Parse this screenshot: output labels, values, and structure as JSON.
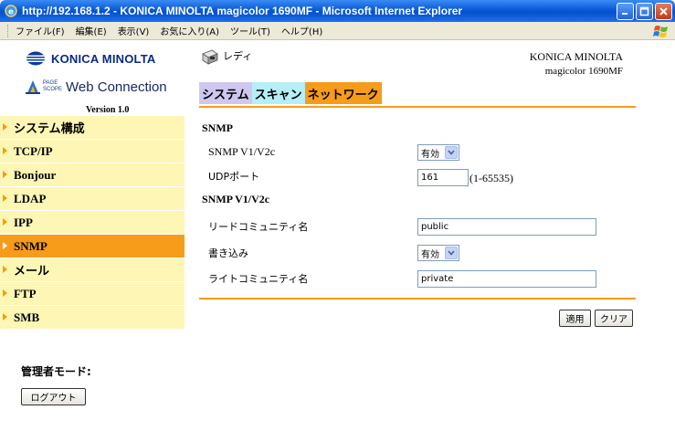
{
  "window": {
    "title": "http://192.168.1.2 - KONICA MINOLTA magicolor 1690MF - Microsoft Internet Explorer"
  },
  "menu": [
    "ファイル(F)",
    "編集(E)",
    "表示(V)",
    "お気に入り(A)",
    "ツール(T)",
    "ヘルプ(H)"
  ],
  "logos": {
    "konica": "KONICA MINOLTA",
    "pagescope_small_1": "PAGE",
    "pagescope_small_2": "SCOPE",
    "webconnection": "Web Connection",
    "version": "Version 1.0"
  },
  "sidebar": {
    "items": [
      {
        "label": "システム構成",
        "active": false
      },
      {
        "label": "TCP/IP",
        "active": false
      },
      {
        "label": "Bonjour",
        "active": false
      },
      {
        "label": "LDAP",
        "active": false
      },
      {
        "label": "IPP",
        "active": false
      },
      {
        "label": "SNMP",
        "active": true
      },
      {
        "label": "メール",
        "active": false
      },
      {
        "label": "FTP",
        "active": false
      },
      {
        "label": "SMB",
        "active": false
      }
    ],
    "admin_label": "管理者モード:",
    "logout_label": "ログアウト"
  },
  "header": {
    "status": "レディ",
    "brand": "KONICA MINOLTA",
    "model": "magicolor 1690MF"
  },
  "tabs": [
    {
      "label": "システム"
    },
    {
      "label": "スキャン"
    },
    {
      "label": "ネットワーク"
    }
  ],
  "form": {
    "section1_title": "SNMP",
    "snmp_v1v2c_label": "SNMP V1/V2c",
    "snmp_v1v2c_value": "有効",
    "udp_port_label": "UDPポート",
    "udp_port_value": "161",
    "udp_port_range": "(1-65535)",
    "section2_title": "SNMP V1/V2c",
    "read_community_label": "リードコミュニティ名",
    "read_community_value": "public",
    "write_label": "書き込み",
    "write_value": "有効",
    "write_community_label": "ライトコミュニティ名",
    "write_community_value": "private"
  },
  "buttons": {
    "apply": "適用",
    "clear": "クリア"
  },
  "colors": {
    "accent_orange": "#f79b1a",
    "nav_bg": "#fdf6b5",
    "tab_system": "#cfc7ef",
    "tab_scan": "#b5eef7"
  }
}
